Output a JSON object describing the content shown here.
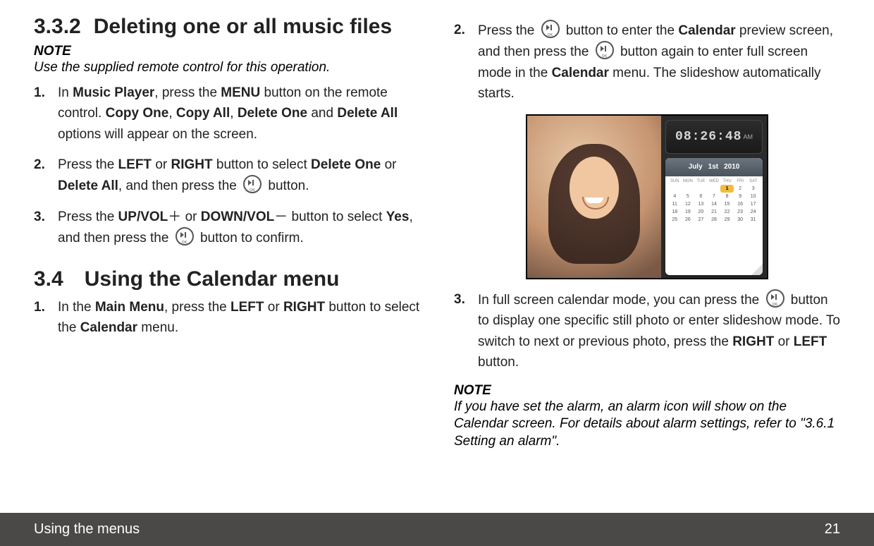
{
  "left": {
    "h332_num": "3.3.2",
    "h332_title": "Deleting one or all music files",
    "note_label": "NOTE",
    "note_text": "Use the supplied remote control for this operation.",
    "steps": {
      "s1": {
        "mk": "1.",
        "t1": "In ",
        "b1": "Music Player",
        "t2": ", press the ",
        "b2": "MENU",
        "t3": " button on the remote control. ",
        "b3": "Copy One",
        "t4": ", ",
        "b4": "Copy All",
        "t5": ", ",
        "b5": "Delete One",
        "t6": " and ",
        "b6": "Delete All",
        "t7": " options will appear on the screen."
      },
      "s2": {
        "mk": "2.",
        "t1": "Press the ",
        "b1": "LEFT",
        "t2": " or ",
        "b2": "RIGHT",
        "t3": " button to select ",
        "b3": "Delete One",
        "t4": " or ",
        "b4": "Delete All",
        "t5": ", and then press the ",
        "t6": " button."
      },
      "s3": {
        "mk": "3.",
        "t1": "Press the ",
        "b1": "UP/VOL",
        "plus": "＋",
        "t2": " or ",
        "b2": "DOWN/VOL",
        "minus": "－",
        "t3": " button to select ",
        "b3": "Yes",
        "t4": ", and then press the ",
        "t5": " button to confirm."
      }
    },
    "h34_num": "3.4",
    "h34_title": "Using the Calendar menu",
    "s34_1": {
      "mk": "1.",
      "t1": "In the ",
      "b1": "Main Menu",
      "t2": ", press the ",
      "b2": "LEFT",
      "t3": " or ",
      "b3": "RIGHT",
      "t4": " button to select the ",
      "b4": "Calendar",
      "t5": " menu."
    }
  },
  "right": {
    "s2": {
      "mk": "2.",
      "t1": "Press the ",
      "t2": " button to enter the ",
      "b1": "Calendar",
      "t3": " preview screen, and then press the ",
      "t4": " button again to enter full screen mode in the ",
      "b2": "Calendar",
      "t5": " menu. The slideshow automatically starts."
    },
    "s3": {
      "mk": "3.",
      "t1": "In full screen calendar mode, you can press the ",
      "t2": " button to display one specific still photo or enter slideshow mode. To switch to next or previous photo, press the ",
      "b1": "RIGHT",
      "t3": " or ",
      "b2": "LEFT",
      "t4": " button."
    },
    "note_label": "NOTE",
    "note_text": "If you have set the alarm, an alarm icon will show on the Calendar screen. For details about alarm settings, refer to \"3.6.1 Setting an alarm\"."
  },
  "figure": {
    "clock_time": "08:26:48",
    "clock_suffix": "AM",
    "cal_month": "July",
    "cal_day": "1st",
    "cal_year": "2010",
    "dow": [
      "SUN",
      "MON",
      "TUE",
      "WED",
      "THU",
      "FRI",
      "SAT"
    ],
    "highlight": "1"
  },
  "footer": {
    "section": "Using the menus",
    "page": "21"
  }
}
